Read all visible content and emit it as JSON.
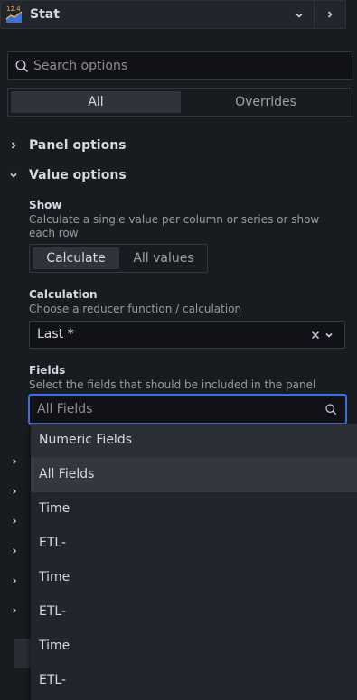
{
  "viz_picker": {
    "badge": "12.4",
    "name": "Stat"
  },
  "search": {
    "placeholder": "Search options"
  },
  "tabs": {
    "all": "All",
    "overrides": "Overrides"
  },
  "sections": {
    "panel_options": "Panel options",
    "value_options": "Value options"
  },
  "show": {
    "label": "Show",
    "description": "Calculate a single value per column or series or show each row",
    "options": [
      "Calculate",
      "All values"
    ],
    "selected": "Calculate"
  },
  "calculation": {
    "label": "Calculation",
    "description": "Choose a reducer function / calculation",
    "value": "Last *"
  },
  "fields": {
    "label": "Fields",
    "description": "Select the fields that should be included in the panel",
    "placeholder": "All Fields"
  },
  "dropdown": {
    "items": [
      "Numeric Fields",
      "All Fields",
      "Time",
      "ETL-",
      "Time",
      "ETL-",
      "Time",
      "ETL-"
    ]
  },
  "colors": {
    "focus": "#3d71d9",
    "background": "#181b1f"
  },
  "icons": [
    "grafana-stat-icon",
    "chevron-down-icon",
    "chevron-right-icon",
    "search-icon",
    "clear-icon"
  ]
}
